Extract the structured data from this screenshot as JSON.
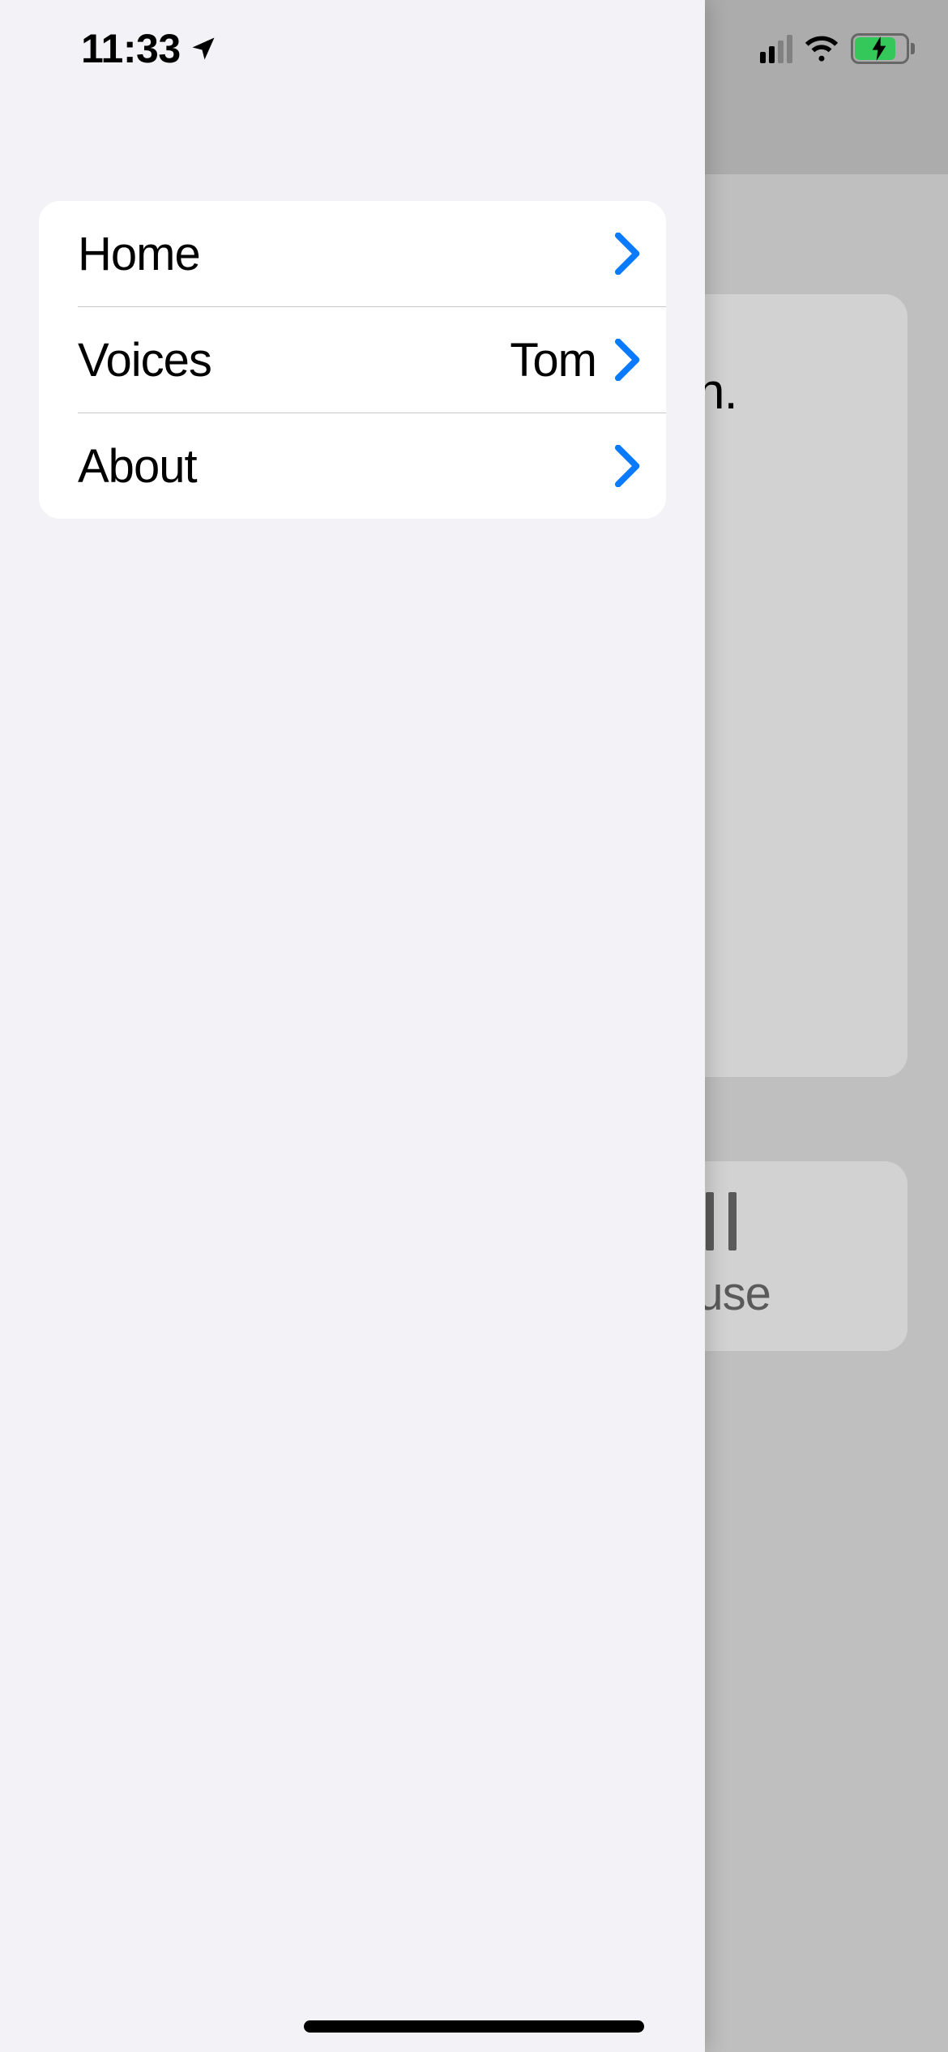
{
  "status": {
    "time": "11:33",
    "location_active": true,
    "cellular_bars_active": 2,
    "cellular_bars_total": 4,
    "wifi_active": true,
    "battery_charging": true,
    "battery_color": "#34c759"
  },
  "drawer": {
    "menu": [
      {
        "key": "home",
        "label": "Home",
        "value": ""
      },
      {
        "key": "voices",
        "label": "Voices",
        "value": "Tom"
      },
      {
        "key": "about",
        "label": "About",
        "value": ""
      }
    ]
  },
  "background": {
    "text_fragment": "n.",
    "pause_button": {
      "label_fragment": "ause"
    }
  },
  "colors": {
    "accent": "#0a7aff",
    "drawer_bg": "#f2f2f7",
    "card_bg": "#ffffff",
    "separator": "#c6c6c8"
  }
}
